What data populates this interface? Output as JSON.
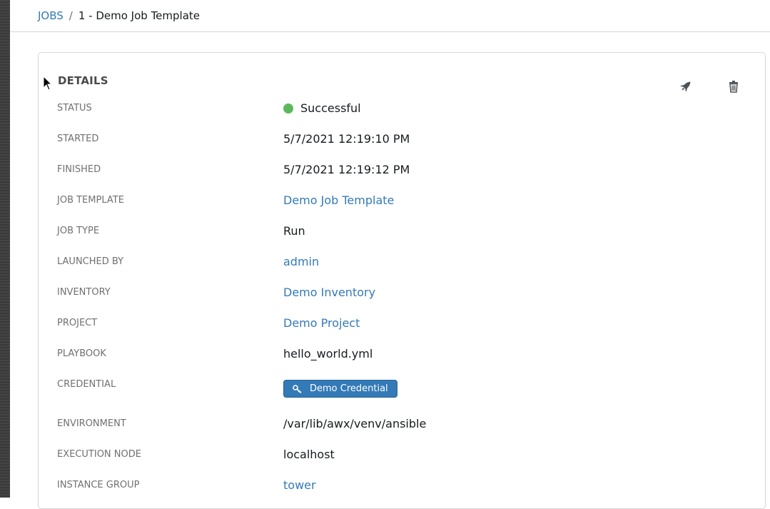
{
  "breadcrumb": {
    "jobs_label": "JOBS",
    "separator": "/",
    "current": "1 - Demo Job Template"
  },
  "panel": {
    "title": "DETAILS"
  },
  "colors": {
    "link": "#337ab7",
    "success": "#5cb85c",
    "label": "#707070"
  },
  "details": {
    "status": {
      "label": "STATUS",
      "value": "Successful"
    },
    "started": {
      "label": "STARTED",
      "value": "5/7/2021 12:19:10 PM"
    },
    "finished": {
      "label": "FINISHED",
      "value": "5/7/2021 12:19:12 PM"
    },
    "job_template": {
      "label": "JOB TEMPLATE",
      "value": "Demo Job Template"
    },
    "job_type": {
      "label": "JOB TYPE",
      "value": "Run"
    },
    "launched_by": {
      "label": "LAUNCHED BY",
      "value": "admin"
    },
    "inventory": {
      "label": "INVENTORY",
      "value": "Demo Inventory"
    },
    "project": {
      "label": "PROJECT",
      "value": "Demo Project"
    },
    "playbook": {
      "label": "PLAYBOOK",
      "value": "hello_world.yml"
    },
    "credential": {
      "label": "CREDENTIAL",
      "value": "Demo Credential"
    },
    "environment": {
      "label": "ENVIRONMENT",
      "value": "/var/lib/awx/venv/ansible"
    },
    "execution_node": {
      "label": "EXECUTION NODE",
      "value": "localhost"
    },
    "instance_group": {
      "label": "INSTANCE GROUP",
      "value": "tower"
    }
  }
}
